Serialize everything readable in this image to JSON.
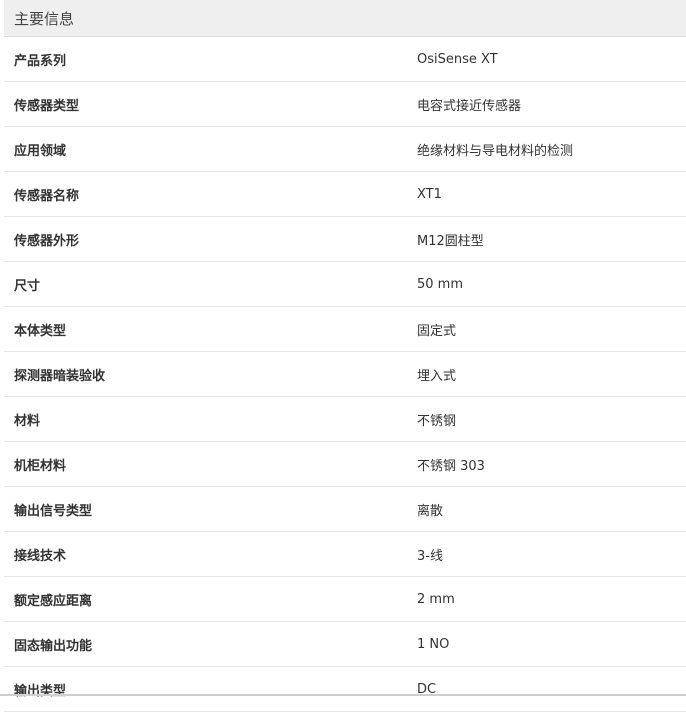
{
  "section": {
    "title": "主要信息"
  },
  "specs": [
    {
      "label": "产品系列",
      "value": "OsiSense XT"
    },
    {
      "label": "传感器类型",
      "value": "电容式接近传感器"
    },
    {
      "label": "应用领域",
      "value": "绝缘材料与导电材料的检测"
    },
    {
      "label": "传感器名称",
      "value": "XT1"
    },
    {
      "label": "传感器外形",
      "value": "M12圆柱型"
    },
    {
      "label": "尺寸",
      "value": "50 mm"
    },
    {
      "label": "本体类型",
      "value": "固定式"
    },
    {
      "label": "探测器暗装验收",
      "value": "埋入式"
    },
    {
      "label": "材料",
      "value": "不锈钢"
    },
    {
      "label": "机柜材料",
      "value": "不锈钢 303"
    },
    {
      "label": "输出信号类型",
      "value": "离散"
    },
    {
      "label": "接线技术",
      "value": "3-线"
    },
    {
      "label": "额定感应距离",
      "value": "2 mm"
    },
    {
      "label": "固态输出功能",
      "value": "1 NO"
    },
    {
      "label": "输出类型",
      "value": "DC"
    }
  ]
}
